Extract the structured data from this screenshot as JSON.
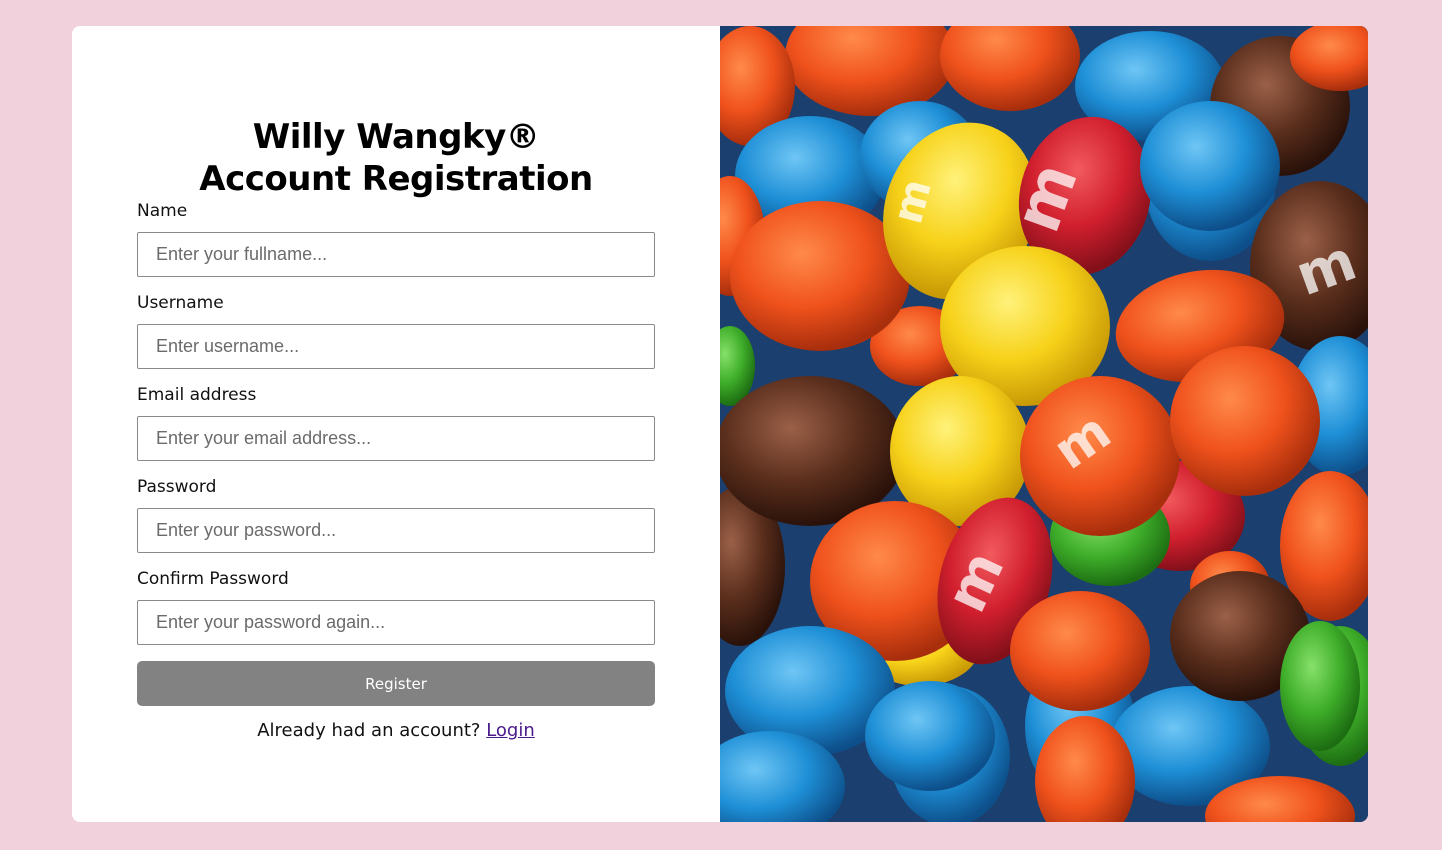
{
  "form": {
    "title_line1": "Willy Wangky®",
    "title_line2": "Account Registration",
    "fields": [
      {
        "label": "Name",
        "placeholder": "Enter your fullname...",
        "type": "text"
      },
      {
        "label": "Username",
        "placeholder": "Enter username...",
        "type": "text"
      },
      {
        "label": "Email address",
        "placeholder": "Enter your email address...",
        "type": "email"
      },
      {
        "label": "Password",
        "placeholder": "Enter your password...",
        "type": "password"
      },
      {
        "label": "Confirm Password",
        "placeholder": "Enter your password again...",
        "type": "password"
      }
    ],
    "register_label": "Register",
    "login_prompt": "Already had an account?",
    "login_link": "Login"
  },
  "hero_image": {
    "subject": "candy-photo",
    "colors": {
      "orange": "#f0521c",
      "yellow": "#f7d21a",
      "red": "#d11f2e",
      "blue": "#1e8fd6",
      "brown": "#5a2e1c",
      "green": "#3fae2a"
    }
  },
  "theme": {
    "page_background": "#f1d1dc",
    "card_background": "#ffffff",
    "button_background": "#828282",
    "link_color": "#4a1a8c"
  }
}
